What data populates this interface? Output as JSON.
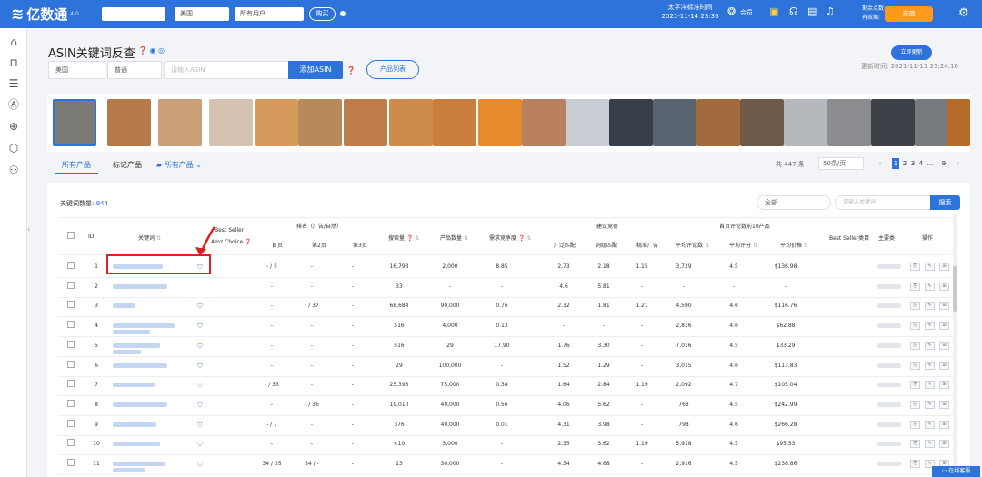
{
  "topbar": {
    "logo_text": "亿数通",
    "logo_sup": "4.0",
    "site_select": "",
    "market_select": "美国",
    "user_select": "所有用户",
    "switch_btn": "购买",
    "bj_time_label": "太平洋标准时间",
    "bj_time_value": "2021-11-14 23:36",
    "vip_label": "会员",
    "vip_info_1": "剩余点数:",
    "vip_info_2": "有效期:",
    "renew_btn": "充值"
  },
  "page": {
    "title": "ASIN关键词反查",
    "country": "美国",
    "mode": "普通",
    "asin_placeholder": "请输入ASIN",
    "add_asin_btn": "添加ASIN",
    "product_list_btn": "产品列表",
    "refresh_btn": "立即更新",
    "query_time_label": "更新时间:",
    "query_time_value": "2021-11-11 23:24:16"
  },
  "tabs": {
    "all_products": "所有产品",
    "tagged_products": "标记产品",
    "all_folders": "所有产品"
  },
  "pager": {
    "total": "共 447 条",
    "per_page": "50条/页",
    "pages": [
      "1",
      "2",
      "3",
      "4",
      "...",
      "9"
    ],
    "current": "1"
  },
  "table": {
    "kw_count_label": "关键词数量:",
    "kw_count": "944",
    "filter_select": "全部",
    "search_placeholder": "请输入关键词",
    "search_btn": "搜索",
    "headers": {
      "id": "ID",
      "keyword": "关键词",
      "best_seller_1": "Best Seller",
      "best_seller_2": "Amz Choice",
      "rank_group": "排名（广告/自然）",
      "page1": "首页",
      "page2": "第2页",
      "page3": "第3页",
      "search_vol": "搜索量",
      "product_count": "产品数量",
      "demand_ratio": "需求竞争度",
      "suggested_bid": "建议竞价",
      "broad": "广泛匹配",
      "phrase": "词组匹配",
      "exact": "精准广告",
      "top10_group": "首页评论数前10产品",
      "avg_reviews": "平均评论数",
      "avg_rating": "平均评分",
      "avg_price": "平均价格",
      "bs_category": "Best Seller类目",
      "main_category": "主要类",
      "actions": "操作"
    },
    "rows": [
      {
        "id": "1",
        "p1": "- / 5",
        "p2": "-",
        "p3": "-",
        "vol": "16,793",
        "cnt": "2,000",
        "ratio": "8.85",
        "b1": "2.73",
        "b2": "2.18",
        "b3": "1.15",
        "rev": "3,729",
        "rate": "4.5",
        "price": "$136.98"
      },
      {
        "id": "2",
        "p1": "-",
        "p2": "-",
        "p3": "-",
        "vol": "33",
        "cnt": "-",
        "ratio": "-",
        "b1": "4.6",
        "b2": "5.81",
        "b3": "-",
        "rev": "-",
        "rate": "-",
        "price": "-"
      },
      {
        "id": "3",
        "p1": "-",
        "p2": "- / 37",
        "p3": "-",
        "vol": "68,684",
        "cnt": "90,000",
        "ratio": "0.76",
        "b1": "2.32",
        "b2": "1.81",
        "b3": "1.21",
        "rev": "4,590",
        "rate": "4.6",
        "price": "$116.76"
      },
      {
        "id": "4",
        "p1": "-",
        "p2": "-",
        "p3": "-",
        "vol": "516",
        "cnt": "4,000",
        "ratio": "0.13",
        "b1": "-",
        "b2": "-",
        "b3": "-",
        "rev": "2,816",
        "rate": "4.6",
        "price": "$62.88"
      },
      {
        "id": "5",
        "p1": "-",
        "p2": "-",
        "p3": "-",
        "vol": "516",
        "cnt": "29",
        "ratio": "17.90",
        "b1": "1.76",
        "b2": "3.30",
        "b3": "-",
        "rev": "7,016",
        "rate": "4.5",
        "price": "$33.29"
      },
      {
        "id": "6",
        "p1": "-",
        "p2": "-",
        "p3": "-",
        "vol": "29",
        "cnt": "100,000",
        "ratio": "-",
        "b1": "1.52",
        "b2": "1.29",
        "b3": "-",
        "rev": "3,015",
        "rate": "4.6",
        "price": "$113.83"
      },
      {
        "id": "7",
        "p1": "- / 33",
        "p2": "-",
        "p3": "-",
        "vol": "25,393",
        "cnt": "75,000",
        "ratio": "0.38",
        "b1": "1.64",
        "b2": "2.84",
        "b3": "1.19",
        "rev": "2,092",
        "rate": "4.7",
        "price": "$105.04"
      },
      {
        "id": "8",
        "p1": "-",
        "p2": "- / 36",
        "p3": "-",
        "vol": "19,010",
        "cnt": "40,000",
        "ratio": "0.56",
        "b1": "4.06",
        "b2": "5.62",
        "b3": "-",
        "rev": "763",
        "rate": "4.5",
        "price": "$242.99"
      },
      {
        "id": "9",
        "p1": "- / 7",
        "p2": "-",
        "p3": "-",
        "vol": "376",
        "cnt": "40,000",
        "ratio": "0.01",
        "b1": "4.31",
        "b2": "3.98",
        "b3": "-",
        "rev": "798",
        "rate": "4.6",
        "price": "$266.28"
      },
      {
        "id": "10",
        "p1": "-",
        "p2": "-",
        "p3": "-",
        "vol": "<10",
        "cnt": "3,000",
        "ratio": "-",
        "b1": "2.35",
        "b2": "3.62",
        "b3": "1.19",
        "rev": "5,918",
        "rate": "4.5",
        "price": "$95.53"
      },
      {
        "id": "11",
        "p1": "34 / 35",
        "p2": "34 / -",
        "p3": "-",
        "vol": "13",
        "cnt": "30,000",
        "ratio": "-",
        "b1": "4.34",
        "b2": "4.68",
        "b3": "-",
        "rev": "2,916",
        "rate": "4.5",
        "price": "$238.86"
      },
      {
        "id": "12",
        "p1": "-",
        "p2": "-",
        "p3": "-",
        "vol": "38",
        "cnt": "10,000",
        "ratio": "0.01",
        "b1": "4.19",
        "b2": "3.41",
        "b3": "-",
        "rev": "2,017",
        "rate": "4.6",
        "price": "$76.52"
      }
    ]
  },
  "cs_btn": "在线客服",
  "colors": {
    "brand": "#2d73d9",
    "highlight": "#e02020",
    "renew": "#ff9a1a"
  }
}
